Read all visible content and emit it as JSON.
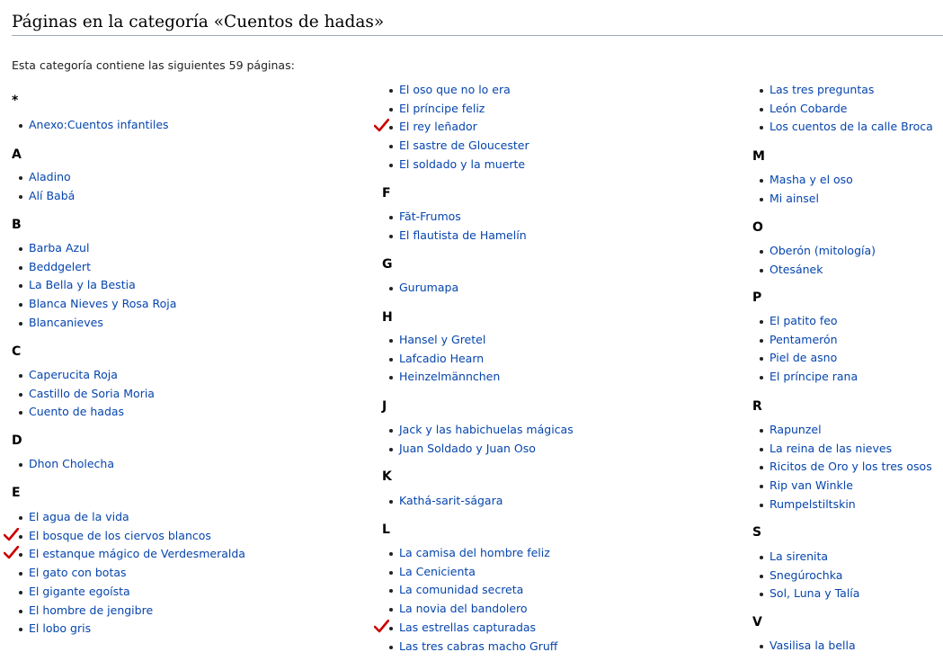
{
  "page_title": "Páginas en la categoría «Cuentos de hadas»",
  "intro": "Esta categoría contiene las siguientes 59 páginas:",
  "colors": {
    "link": "#0645ad",
    "check": "#cc0000",
    "rule": "#a2a9b1"
  },
  "groups": {
    "star": {
      "letter": "*",
      "items": [
        "Anexo:Cuentos infantiles"
      ]
    },
    "A": {
      "letter": "A",
      "items": [
        "Aladino",
        "Alí Babá"
      ]
    },
    "B": {
      "letter": "B",
      "items": [
        "Barba Azul",
        "Beddgelert",
        "La Bella y la Bestia",
        "Blanca Nieves y Rosa Roja",
        "Blancanieves"
      ]
    },
    "C": {
      "letter": "C",
      "items": [
        "Caperucita Roja",
        "Castillo de Soria Moria",
        "Cuento de hadas"
      ]
    },
    "D": {
      "letter": "D",
      "items": [
        "Dhon Cholecha"
      ]
    },
    "E": {
      "letter": "E",
      "items": [
        "El agua de la vida",
        "El bosque de los ciervos blancos",
        "El estanque mágico de Verdesmeralda",
        "El gato con botas",
        "El gigante egoísta",
        "El hombre de jengibre",
        "El lobo gris",
        "El oso que no lo era",
        "El príncipe feliz",
        "El rey leñador",
        "El sastre de Gloucester",
        "El soldado y la muerte"
      ]
    },
    "F": {
      "letter": "F",
      "items": [
        "Făt-Frumos",
        "El flautista de Hamelín"
      ]
    },
    "G": {
      "letter": "G",
      "items": [
        "Gurumapa"
      ]
    },
    "H": {
      "letter": "H",
      "items": [
        "Hansel y Gretel",
        "Lafcadio Hearn",
        "Heinzelmännchen"
      ]
    },
    "J": {
      "letter": "J",
      "items": [
        "Jack y las habichuelas mágicas",
        "Juan Soldado y Juan Oso"
      ]
    },
    "K": {
      "letter": "K",
      "items": [
        "Kathá-sarit-ságara"
      ]
    },
    "L": {
      "letter": "L",
      "items": [
        "La camisa del hombre feliz",
        "La Cenicienta",
        "La comunidad secreta",
        "La novia del bandolero",
        "Las estrellas capturadas",
        "Las tres cabras macho Gruff",
        "Las tres preguntas",
        "León Cobarde",
        "Los cuentos de la calle Broca"
      ]
    },
    "M": {
      "letter": "M",
      "items": [
        "Masha y el oso",
        "Mi ainsel"
      ]
    },
    "O": {
      "letter": "O",
      "items": [
        "Oberón (mitología)",
        "Otesánek"
      ]
    },
    "P": {
      "letter": "P",
      "items": [
        "El patito feo",
        "Pentamerón",
        "Piel de asno",
        "El príncipe rana"
      ]
    },
    "R": {
      "letter": "R",
      "items": [
        "Rapunzel",
        "La reina de las nieves",
        "Ricitos de Oro y los tres osos",
        "Rip van Winkle",
        "Rumpelstiltskin"
      ]
    },
    "S": {
      "letter": "S",
      "items": [
        "La sirenita",
        "Snegúrochka",
        "Sol, Luna y Talía"
      ]
    },
    "V": {
      "letter": "V",
      "items": [
        "Vasilisa la bella"
      ]
    }
  },
  "checked_icon": "checkmark-icon"
}
